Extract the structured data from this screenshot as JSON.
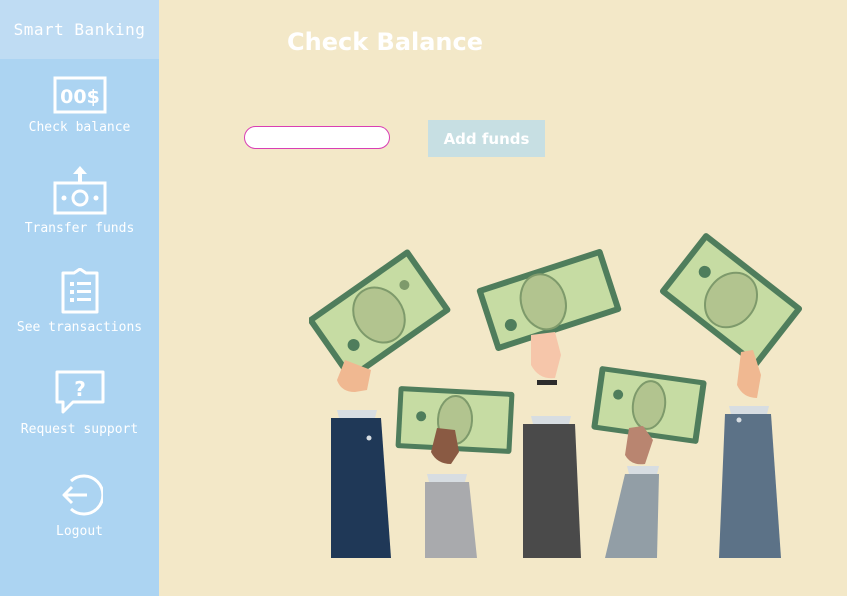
{
  "app": {
    "title": "Smart Banking"
  },
  "sidebar": {
    "items": [
      {
        "label": "Check balance",
        "icon": "money-bill-icon"
      },
      {
        "label": "Transfer funds",
        "icon": "money-transfer-icon"
      },
      {
        "label": "See transactions",
        "icon": "clipboard-list-icon"
      },
      {
        "label": "Request support",
        "icon": "question-bubble-icon"
      },
      {
        "label": "Logout",
        "icon": "logout-icon"
      }
    ]
  },
  "main": {
    "title": "Check Balance",
    "amount_input": {
      "value": "",
      "placeholder": ""
    },
    "add_funds_label": "Add funds"
  },
  "illustration": {
    "icon": "hands-holding-money-illustration"
  },
  "colors": {
    "background": "#f3e8c8",
    "sidebar": "#acd4f2",
    "sidebar_header": "#bfdcf3",
    "input_border": "#d93fb4",
    "button": "#c7dfe3",
    "text_light": "#ffffff"
  }
}
